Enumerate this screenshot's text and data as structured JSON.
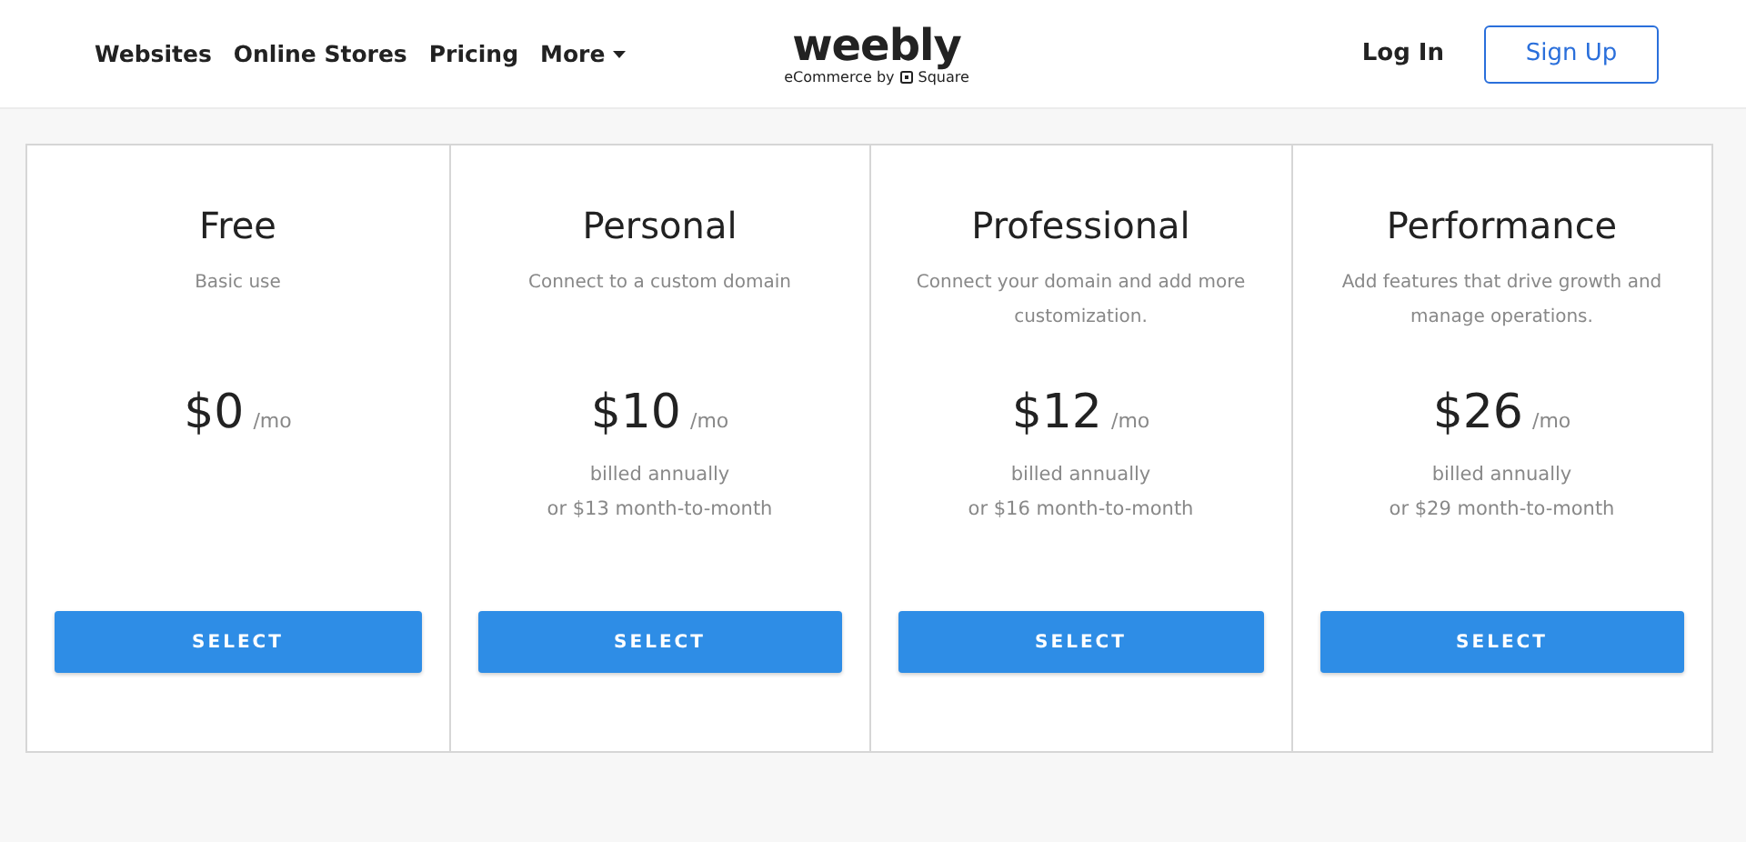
{
  "nav": {
    "links": [
      "Websites",
      "Online Stores",
      "Pricing",
      "More"
    ],
    "logo": "weebly",
    "tagline": "eCommerce by",
    "tagline_brand": "Square",
    "login": "Log In",
    "signup": "Sign Up"
  },
  "plans": [
    {
      "name": "Free",
      "description": "Basic use",
      "price": "$0",
      "unit": "/mo",
      "button": "SELECT"
    },
    {
      "name": "Personal",
      "description": "Connect to a custom domain",
      "price": "$10",
      "unit": "/mo",
      "billing": [
        "billed annually",
        "or $13 month-to-month"
      ],
      "button": "SELECT"
    },
    {
      "name": "Professional",
      "description": "Connect your domain and add more customization.",
      "price": "$12",
      "unit": "/mo",
      "billing": [
        "billed annually",
        "or $16 month-to-month"
      ],
      "button": "SELECT"
    },
    {
      "name": "Performance",
      "description": "Add features that drive growth and manage operations.",
      "price": "$26",
      "unit": "/mo",
      "billing": [
        "billed annually",
        "or $29 month-to-month"
      ],
      "button": "SELECT"
    }
  ]
}
